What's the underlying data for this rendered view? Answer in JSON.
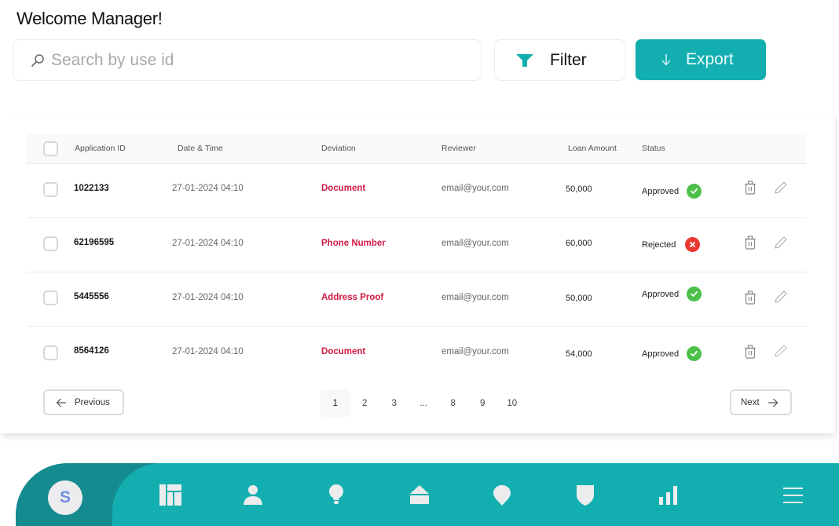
{
  "header": {
    "welcome": "Welcome Manager!"
  },
  "search": {
    "placeholder": "Search by use id",
    "value": "",
    "icon": "search-icon"
  },
  "toolbar": {
    "filter_label": "Filter",
    "filter_icon": "filter-icon",
    "export_label": "Export",
    "export_icon": "arrow-down-icon"
  },
  "colors": {
    "accent": "#13afb0",
    "accent_dark": "#158b8f",
    "deviation": "#d11a45",
    "approved": "#4cc04a",
    "rejected": "#e9382f",
    "avatar_letter": "#6f8fdc"
  },
  "table": {
    "columns": [
      "Application ID",
      "Date & Time",
      "Deviation",
      "Reviewer",
      "Loan Amount",
      "Status"
    ],
    "rows": [
      {
        "id": "1022133",
        "datetime": "27-01-2024 04:10",
        "deviation": "Document",
        "reviewer": "email@your.com",
        "amount": "50,000",
        "status": "Approved"
      },
      {
        "id": "62196595",
        "datetime": "27-01-2024 04:10",
        "deviation": "Phone Number",
        "reviewer": "email@your.com",
        "amount": "60,000",
        "status": "Rejected"
      },
      {
        "id": "5445556",
        "datetime": "27-01-2024 04:10",
        "deviation": "Address Proof",
        "reviewer": "email@your.com",
        "amount": "50,000",
        "status": "Approved"
      },
      {
        "id": "8564126",
        "datetime": "27-01-2024 04:10",
        "deviation": "Document",
        "reviewer": "email@your.com",
        "amount": "54,000",
        "status": "Approved"
      }
    ]
  },
  "pagination": {
    "previous_label": "Previous",
    "next_label": "Next",
    "pages": [
      "1",
      "2",
      "3",
      "...",
      "8",
      "9",
      "10"
    ],
    "current_page": "1"
  },
  "bottom_nav": {
    "avatar_letter": "S",
    "items": [
      {
        "name": "dashboard-icon"
      },
      {
        "name": "user-icon"
      },
      {
        "name": "lightbulb-icon"
      },
      {
        "name": "home-icon"
      },
      {
        "name": "location-pin-icon"
      },
      {
        "name": "shield-icon"
      },
      {
        "name": "bar-chart-icon"
      },
      {
        "name": "menu-icon"
      }
    ]
  }
}
